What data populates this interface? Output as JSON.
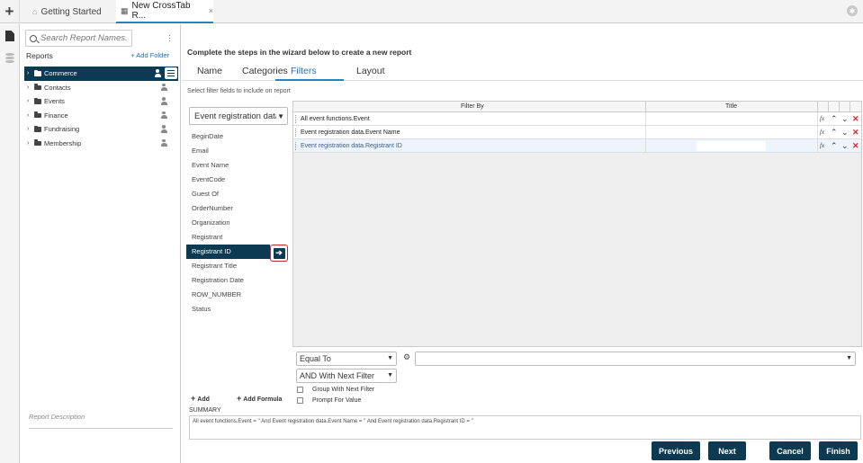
{
  "tabs": [
    {
      "label": "Getting Started",
      "icon": "home-icon"
    },
    {
      "label": "New CrossTab R...",
      "icon": "report-icon",
      "close": "×"
    }
  ],
  "reports_panel": {
    "search_placeholder": "Search Report Names.",
    "title": "Reports",
    "add_folder": "+ Add Folder",
    "folders": [
      "Commerce",
      "Contacts",
      "Events",
      "Finance",
      "Fundraising",
      "Membership"
    ],
    "selected_folder": "Commerce",
    "description_label": "Report Description"
  },
  "wizard": {
    "title": "Complete the steps in the wizard below to create a new report",
    "tabs": [
      "Name",
      "Categories",
      "Filters",
      "Layout"
    ],
    "active_tab": "Filters",
    "hint": "Select filter fields to include on report",
    "source_select": "Event registration data",
    "fields": [
      "BeginDate",
      "Email",
      "Event Name",
      "EventCode",
      "Guest Of",
      "OrderNumber",
      "Organization",
      "Registrant",
      "Registrant ID",
      "Registrant Title",
      "Registration Date",
      "ROW_NUMBER",
      "Status"
    ],
    "selected_field": "Registrant ID",
    "grid": {
      "col_filter_by": "Filter By",
      "col_title": "Title",
      "rows": [
        {
          "filter_by": "All event functions.Event",
          "title": ""
        },
        {
          "filter_by": "Event registration data.Event Name",
          "title": ""
        },
        {
          "filter_by": "Event registration data.Registrant ID",
          "title": ""
        }
      ],
      "fx_label": "fx"
    },
    "operator_select": "Equal To",
    "value_select": "",
    "join_select": "AND With Next Filter",
    "group_with_next": "Group With Next Filter",
    "prompt_for_value": "Prompt For Value",
    "add_label": "Add",
    "add_formula_label": "Add Formula",
    "summary_label": "SUMMARY",
    "summary_text": "All event functions.Event = '' And Event registration data.Event Name = '' And Event registration data.Registrant ID = ''"
  },
  "buttons": {
    "previous": "Previous",
    "next": "Next",
    "cancel": "Cancel",
    "finish": "Finish"
  }
}
